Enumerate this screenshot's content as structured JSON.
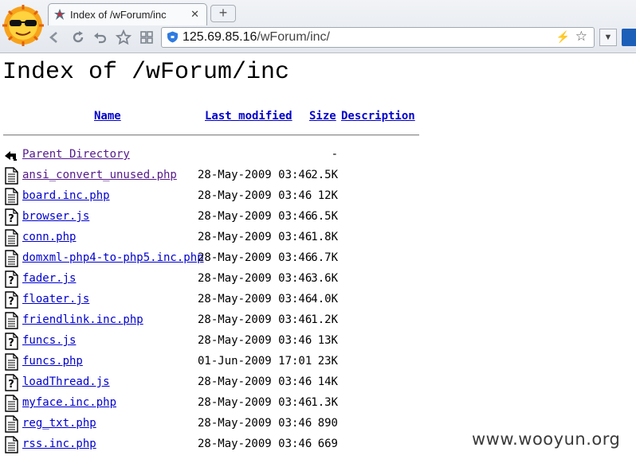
{
  "browser": {
    "tab_title": "Index of /wForum/inc",
    "tab_close": "✕",
    "new_tab": "+",
    "url_host": "125.69.85.16",
    "url_path": "/wForum/inc/",
    "bolt": "⚡",
    "star": "☆",
    "menu": "▼"
  },
  "page": {
    "title": "Index of /wForum/inc",
    "headers": {
      "name": "Name",
      "modified": "Last modified",
      "size": "Size",
      "description": "Description"
    },
    "rows": [
      {
        "icon": "back-icon",
        "name": "Parent Directory",
        "date": "",
        "size": "-",
        "visited": true
      },
      {
        "icon": "text-file-icon",
        "name": "ansi_convert_unused.php",
        "date": "28-May-2009 03:46",
        "size": "2.5K",
        "visited": true
      },
      {
        "icon": "text-file-icon",
        "name": "board.inc.php",
        "date": "28-May-2009 03:46",
        "size": "12K"
      },
      {
        "icon": "unknown-file-icon",
        "name": "browser.js",
        "date": "28-May-2009 03:46",
        "size": "6.5K"
      },
      {
        "icon": "text-file-icon",
        "name": "conn.php",
        "date": "28-May-2009 03:46",
        "size": "1.8K"
      },
      {
        "icon": "text-file-icon",
        "name": "domxml-php4-to-php5.inc.php",
        "date": "28-May-2009 03:46",
        "size": "6.7K"
      },
      {
        "icon": "unknown-file-icon",
        "name": "fader.js",
        "date": "28-May-2009 03:46",
        "size": "3.6K"
      },
      {
        "icon": "unknown-file-icon",
        "name": "floater.js",
        "date": "28-May-2009 03:46",
        "size": "4.0K"
      },
      {
        "icon": "text-file-icon",
        "name": "friendlink.inc.php",
        "date": "28-May-2009 03:46",
        "size": "1.2K"
      },
      {
        "icon": "unknown-file-icon",
        "name": "funcs.js",
        "date": "28-May-2009 03:46",
        "size": "13K"
      },
      {
        "icon": "text-file-icon",
        "name": "funcs.php",
        "date": "01-Jun-2009 17:01",
        "size": "23K"
      },
      {
        "icon": "unknown-file-icon",
        "name": "loadThread.js",
        "date": "28-May-2009 03:46",
        "size": "14K"
      },
      {
        "icon": "text-file-icon",
        "name": "myface.inc.php",
        "date": "28-May-2009 03:46",
        "size": "1.3K"
      },
      {
        "icon": "text-file-icon",
        "name": "reg_txt.php",
        "date": "28-May-2009 03:46",
        "size": "890"
      },
      {
        "icon": "text-file-icon",
        "name": "rss.inc.php",
        "date": "28-May-2009 03:46",
        "size": "669"
      }
    ]
  },
  "watermark": "www.wooyun.org",
  "colors": {
    "link": "#0000cc",
    "visited": "#551a8b"
  }
}
